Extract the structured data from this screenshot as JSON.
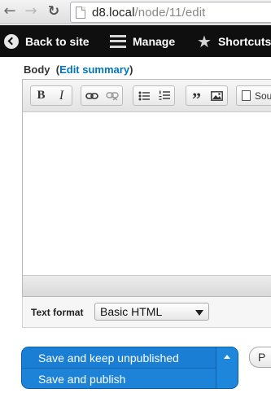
{
  "browser": {
    "url_host": "d8.local",
    "url_path": "/node/11/edit"
  },
  "toolbar": {
    "back_label": "Back to site",
    "manage_label": "Manage",
    "shortcuts_label": "Shortcuts"
  },
  "body_field": {
    "label": "Body",
    "edit_summary_open": "(",
    "edit_summary_link": "Edit summary",
    "edit_summary_close": ")"
  },
  "editor": {
    "bold_glyph": "B",
    "italic_glyph": "I",
    "source_label": "Sou",
    "content": ""
  },
  "text_format": {
    "label": "Text format",
    "selected": "Basic HTML"
  },
  "actions": {
    "primary": "Save and keep unpublished",
    "secondary": "Save and publish",
    "preview": "P"
  },
  "colors": {
    "toolbar_bg": "#0f0f0f",
    "link": "#0074bd",
    "dropbutton": "#1b82d6"
  }
}
